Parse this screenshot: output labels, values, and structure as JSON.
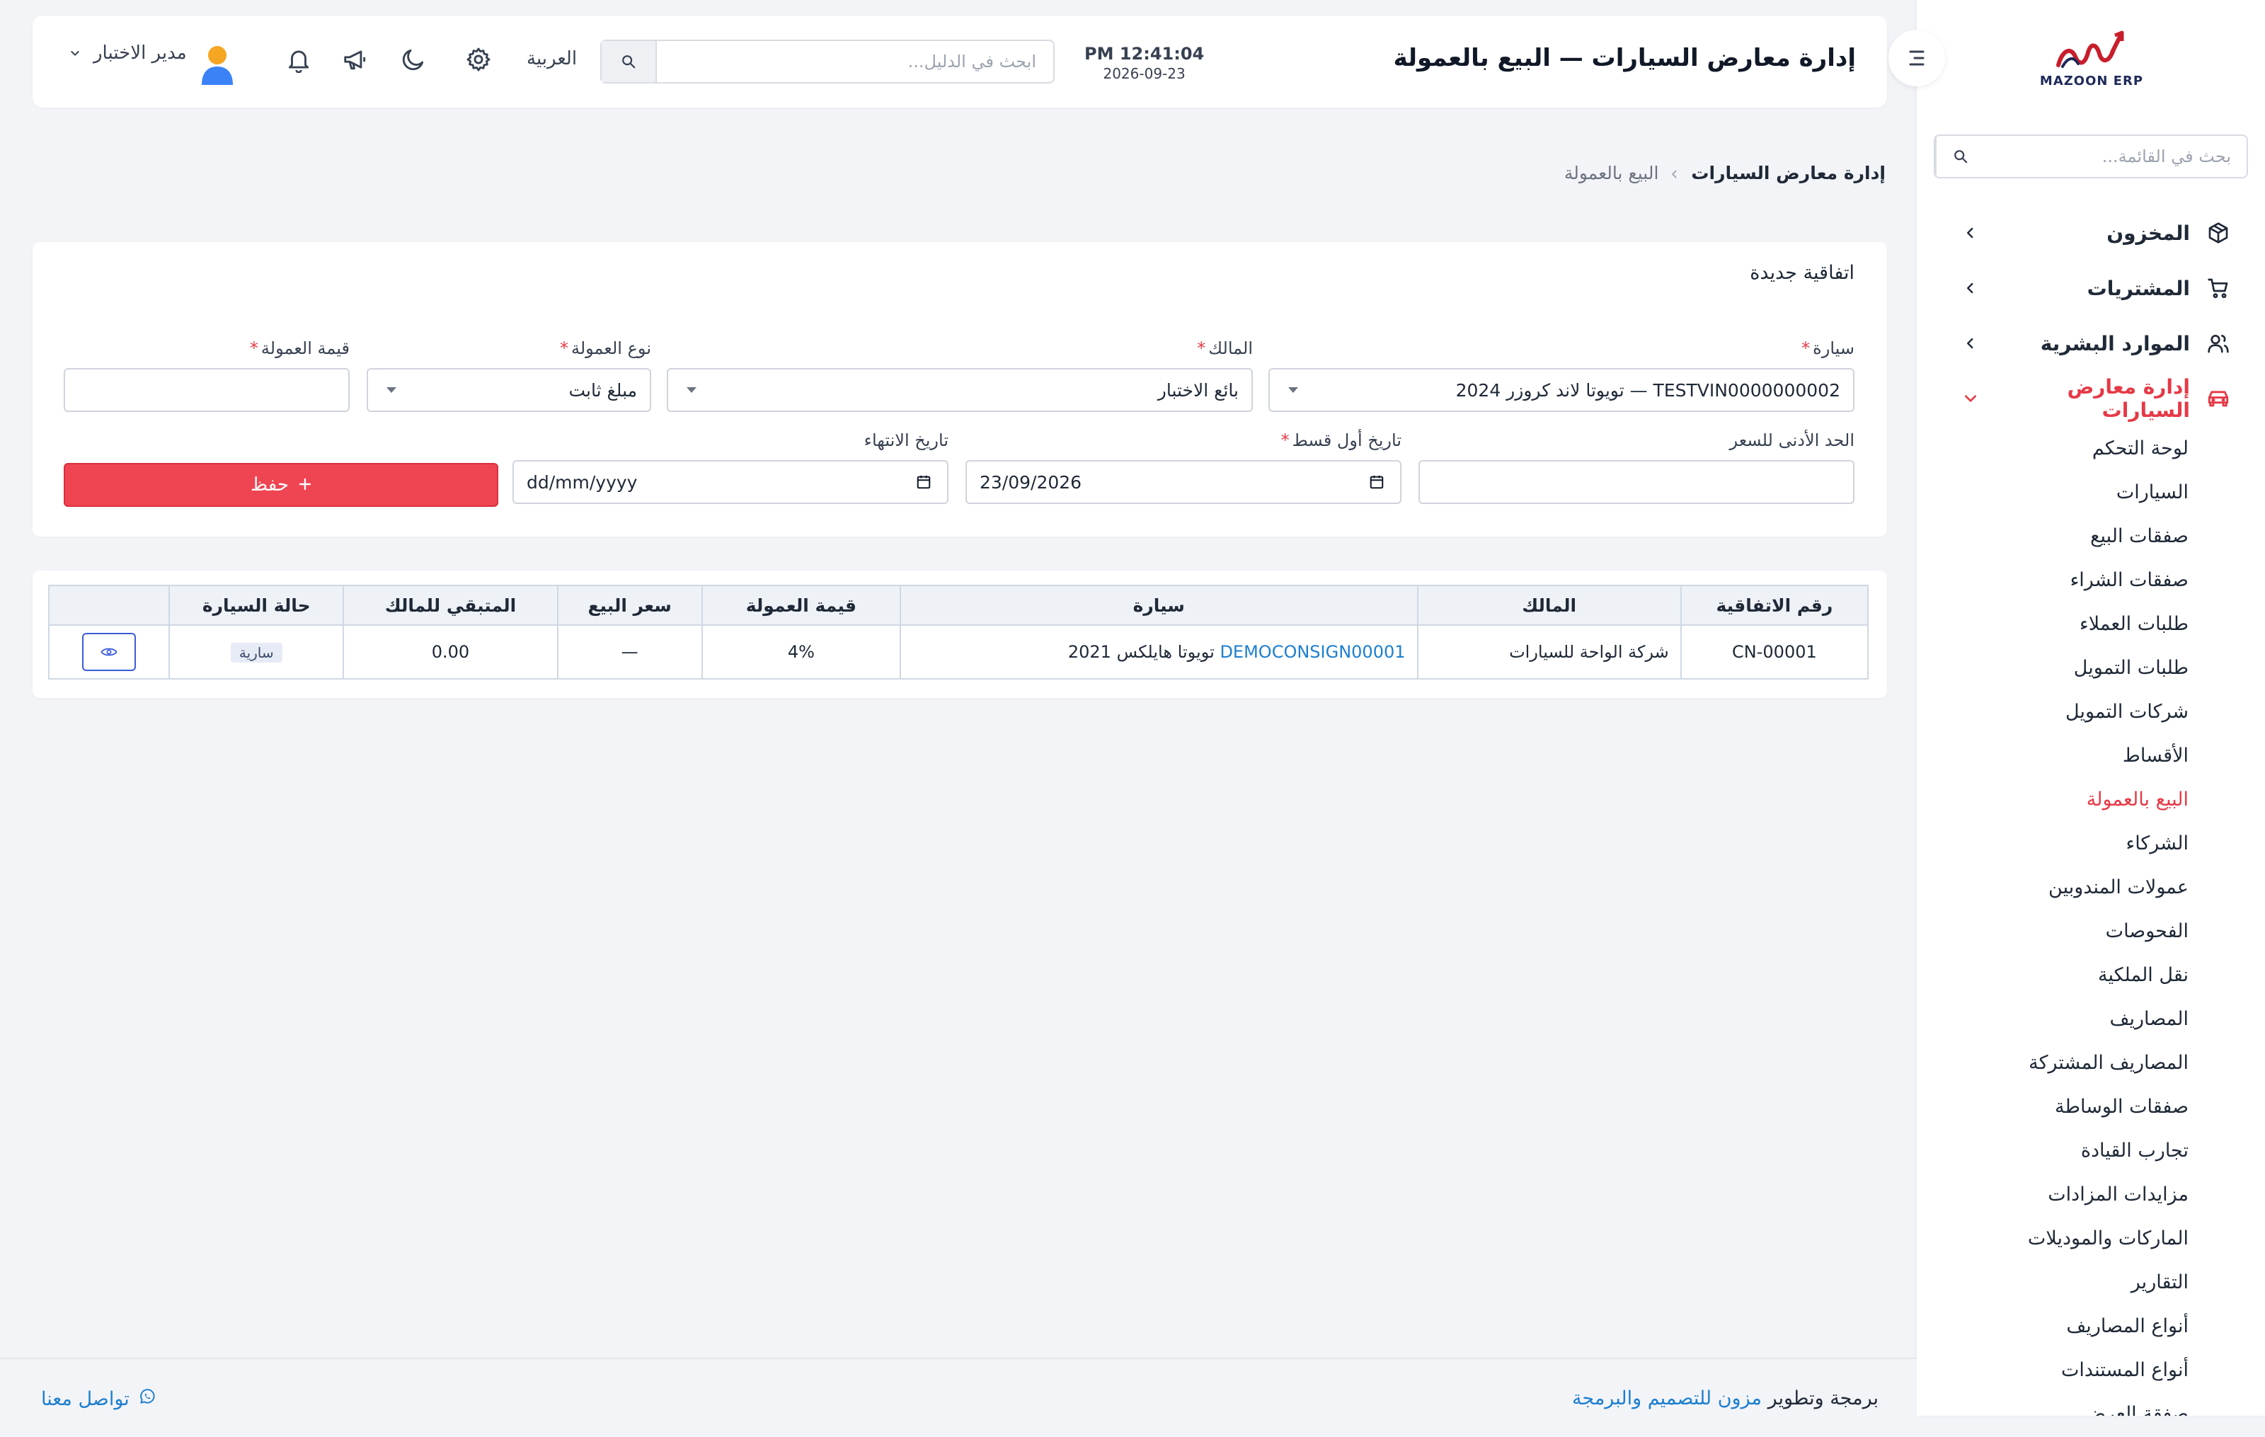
{
  "app": {
    "logo_text": "MAZOON ERP"
  },
  "sidebar": {
    "search_placeholder": "بحث في القائمة...",
    "items": [
      {
        "label": "المخزون",
        "icon": "box-icon"
      },
      {
        "label": "المشتريات",
        "icon": "cart-icon"
      },
      {
        "label": "الموارد البشرية",
        "icon": "users-icon"
      },
      {
        "label": "إدارة معارض السيارات",
        "icon": "car-icon",
        "active": true
      }
    ],
    "submenu": [
      "لوحة التحكم",
      "السيارات",
      "صفقات البيع",
      "صفقات الشراء",
      "طلبات العملاء",
      "طلبات التمويل",
      "شركات التمويل",
      "الأقساط",
      "البيع بالعمولة",
      "الشركاء",
      "عمولات المندوبين",
      "الفحوصات",
      "نقل الملكية",
      "المصاريف",
      "المصاريف المشتركة",
      "صفقات الوساطة",
      "تجارب القيادة",
      "مزايدات المزادات",
      "الماركات والموديلات",
      "التقارير",
      "أنواع المصاريف",
      "أنواع المستندات",
      "صفقة العرض"
    ],
    "active_submenu": "البيع بالعمولة"
  },
  "header": {
    "title": "إدارة معارض السيارات — البيع بالعمولة",
    "time": "PM 12:41:04",
    "date": "2026-09-23",
    "search_placeholder": "ابحث في الدليل...",
    "language": "العربية",
    "user_name": "مدير الاختبار"
  },
  "breadcrumb": {
    "root": "إدارة معارض السيارات",
    "current": "البيع بالعمولة"
  },
  "form": {
    "title": "اتفاقية جديدة",
    "car_label": "سيارة",
    "car_value": "TESTVIN0000000002 — تويوتا لاند كروزر 2024",
    "owner_label": "المالك",
    "owner_value": "بائع الاختبار",
    "commission_type_label": "نوع العمولة",
    "commission_type_value": "مبلغ ثابت",
    "commission_value_label": "قيمة العمولة",
    "commission_value_value": "",
    "min_price_label": "الحد الأدنى للسعر",
    "min_price_value": "",
    "first_installment_label": "تاريخ أول قسط",
    "first_installment_value": "23/09/2026",
    "end_date_label": "تاريخ الانتهاء",
    "end_date_value": "dd/mm/yyyy",
    "save_label": "حفظ"
  },
  "table": {
    "columns": [
      "رقم الاتفاقية",
      "المالك",
      "سيارة",
      "قيمة العمولة",
      "سعر البيع",
      "المتبقي للمالك",
      "حالة السيارة",
      ""
    ],
    "rows": [
      {
        "agreement_no": "CN-00001",
        "owner": "شركة الواحة للسيارات",
        "car_code": "DEMOCONSIGN00001",
        "car_name": "تويوتا هايلكس 2021",
        "commission": "4%",
        "sale_price": "—",
        "remaining": "0.00",
        "status": "سارية"
      }
    ]
  },
  "footer": {
    "credit_prefix": "برمجة وتطوير",
    "credit_brand": "مزون للتصميم والبرمجة",
    "contact": "تواصل معنا"
  },
  "colors": {
    "accent": "#e63946",
    "save_button": "#ef4452",
    "link": "#1d7fcf",
    "background": "#f3f4f8"
  }
}
